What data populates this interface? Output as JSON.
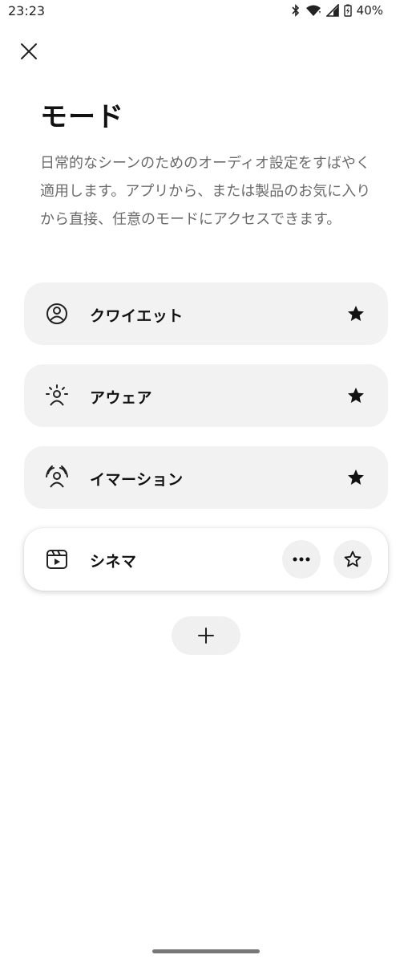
{
  "status_bar": {
    "time": "23:23",
    "battery": "40%"
  },
  "header": {
    "title": "モード",
    "description": "日常的なシーンのためのオーディオ設定をすばやく適用します。アプリから、または製品のお気に入りから直接、任意のモードにアクセスできます。"
  },
  "modes": [
    {
      "label": "クワイエット",
      "icon": "quiet-person-icon",
      "favorite": true
    },
    {
      "label": "アウェア",
      "icon": "aware-person-icon",
      "favorite": true
    },
    {
      "label": "イマーション",
      "icon": "immersion-person-icon",
      "favorite": true
    },
    {
      "label": "シネマ",
      "icon": "cinema-icon",
      "favorite": false,
      "selected": true
    }
  ],
  "actions": {
    "add_icon": "plus-icon",
    "more_icon": "more-horizontal-icon"
  }
}
